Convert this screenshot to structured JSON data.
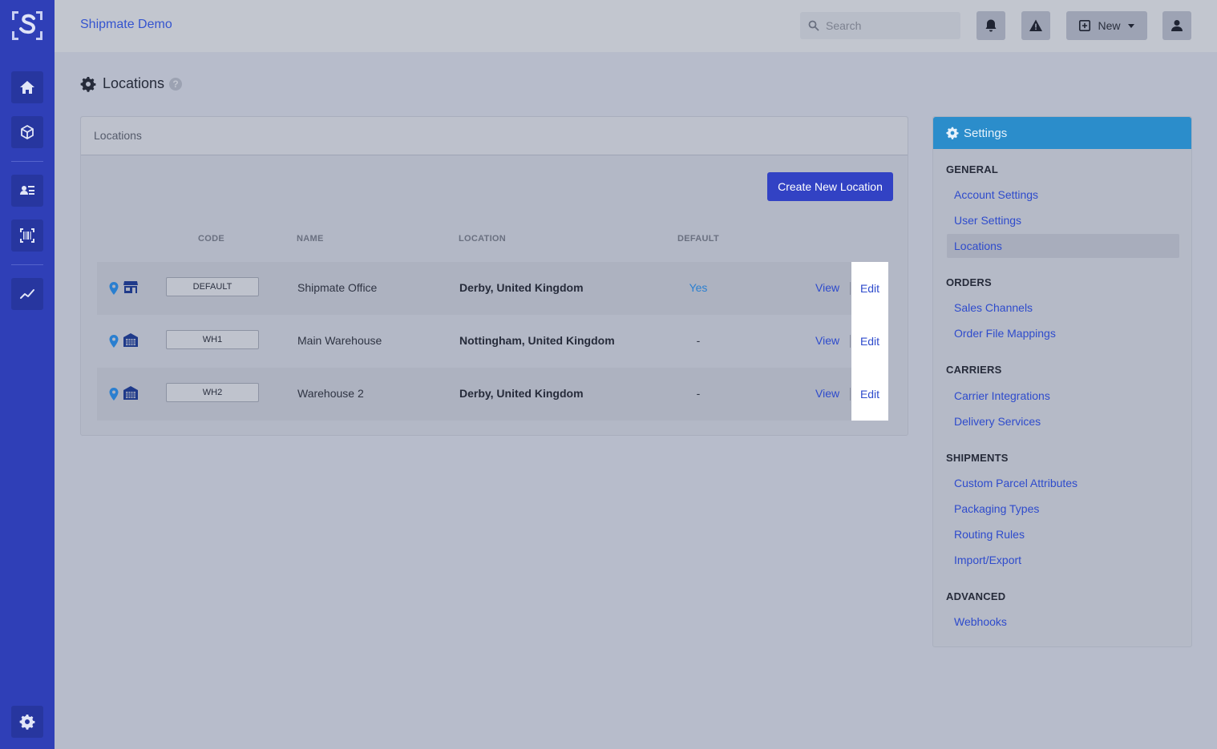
{
  "app": {
    "title": "Shipmate Demo"
  },
  "topbar": {
    "search_placeholder": "Search",
    "new_label": "New"
  },
  "page": {
    "title": "Locations"
  },
  "card": {
    "header": "Locations",
    "create_button": "Create New Location",
    "columns": {
      "code": "CODE",
      "name": "NAME",
      "location": "LOCATION",
      "default": "DEFAULT"
    },
    "rows": [
      {
        "code": "DEFAULT",
        "name": "Shipmate Office",
        "location": "Derby, United Kingdom",
        "default": "Yes",
        "view": "View",
        "edit": "Edit",
        "icon": "store-icon"
      },
      {
        "code": "WH1",
        "name": "Main Warehouse",
        "location": "Nottingham, United Kingdom",
        "default": "-",
        "view": "View",
        "edit": "Edit",
        "icon": "warehouse-icon"
      },
      {
        "code": "WH2",
        "name": "Warehouse 2",
        "location": "Derby, United Kingdom",
        "default": "-",
        "view": "View",
        "edit": "Edit",
        "icon": "warehouse-icon"
      }
    ]
  },
  "settings": {
    "title": "Settings",
    "sections": [
      {
        "title": "GENERAL",
        "items": [
          "Account Settings",
          "User Settings",
          "Locations"
        ]
      },
      {
        "title": "ORDERS",
        "items": [
          "Sales Channels",
          "Order File Mappings"
        ]
      },
      {
        "title": "CARRIERS",
        "items": [
          "Carrier Integrations",
          "Delivery Services"
        ]
      },
      {
        "title": "SHIPMENTS",
        "items": [
          "Custom Parcel Attributes",
          "Packaging Types",
          "Routing Rules",
          "Import/Export"
        ]
      },
      {
        "title": "ADVANCED",
        "items": [
          "Webhooks"
        ]
      }
    ],
    "active_item": "Locations"
  },
  "colors": {
    "sidebar": "#2f3fb7",
    "accent": "#3242c4",
    "settings_header": "#2b8dcb",
    "link": "#2e4bcc"
  }
}
